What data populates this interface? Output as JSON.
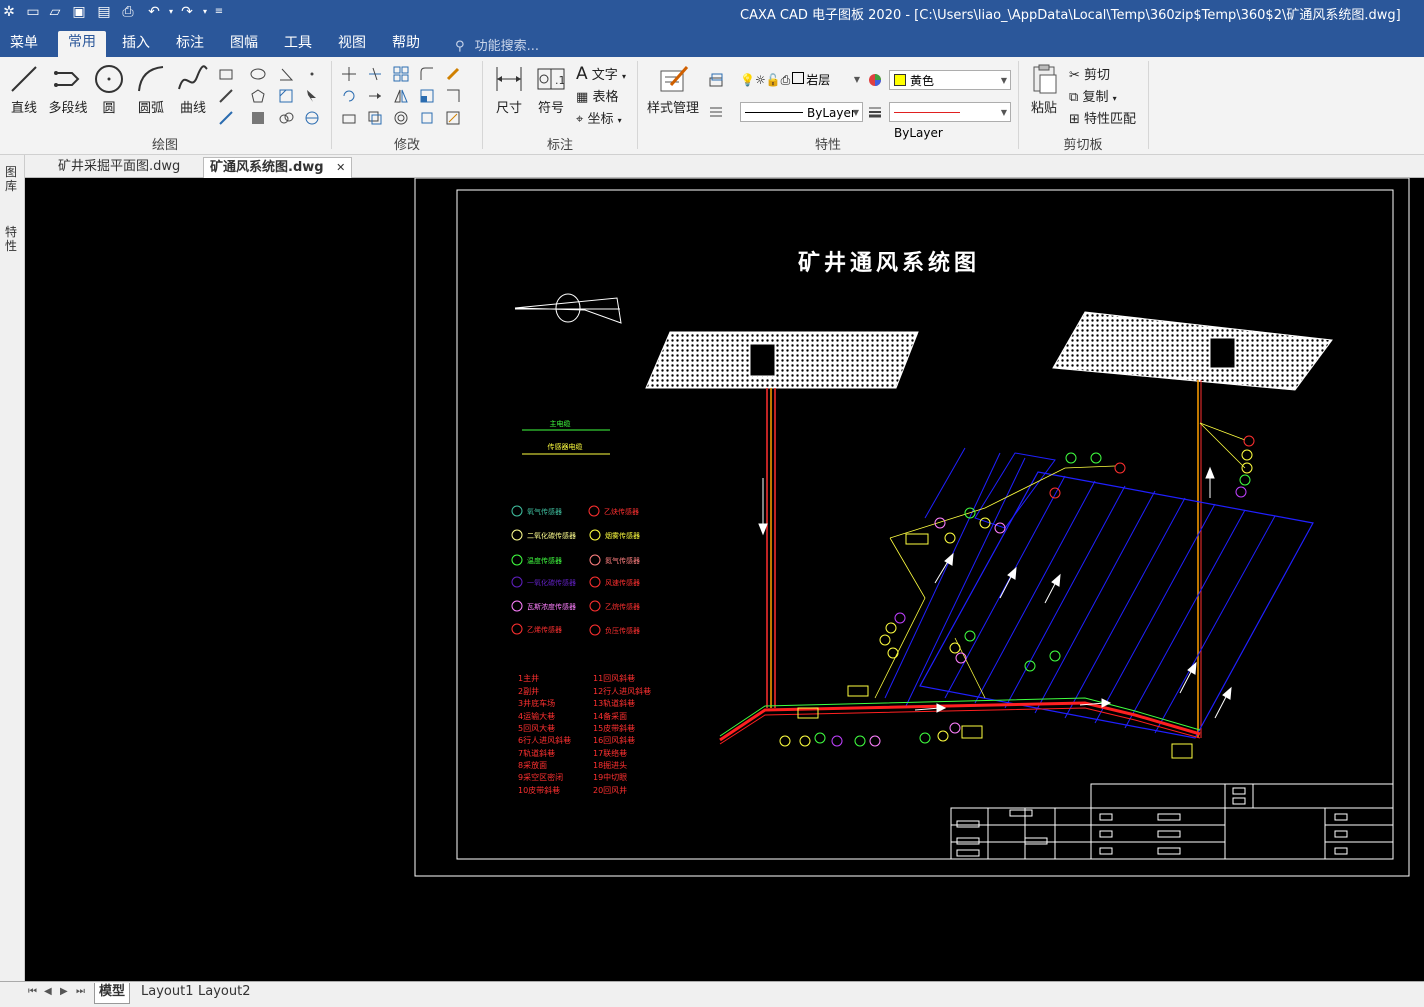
{
  "window": {
    "title": "CAXA CAD 电子图板 2020 - [C:\\Users\\liao_\\AppData\\Local\\Temp\\360zip$Temp\\360$2\\矿通风系统图.dwg]"
  },
  "menu": {
    "tabs": [
      "菜单",
      "常用",
      "插入",
      "标注",
      "图幅",
      "工具",
      "视图",
      "帮助"
    ],
    "active": "常用",
    "search_placeholder": "功能搜索..."
  },
  "ribbon": {
    "draw": {
      "label": "绘图",
      "line": "直线",
      "polyline": "多段线",
      "circle": "圆",
      "arc": "圆弧",
      "curve": "曲线"
    },
    "modify": {
      "label": "修改"
    },
    "annotate": {
      "label": "标注",
      "dimension": "尺寸",
      "symbol": "符号",
      "text": "文字",
      "table": "表格",
      "coord": "坐标"
    },
    "properties": {
      "label": "特性",
      "style_manager": "样式管理",
      "layer": "岩层",
      "color": "黄色",
      "linetype": "ByLayer",
      "lineweight": "ByLayer"
    },
    "clipboard": {
      "label": "剪切板",
      "paste": "粘贴",
      "cut": "剪切",
      "copy": "复制",
      "match": "特性匹配"
    }
  },
  "doc_tabs": [
    "矿井采掘平面图.dwg",
    "矿通风系统图.dwg"
  ],
  "active_doc": "矿通风系统图.dwg",
  "left_palette": [
    "图库",
    "特性"
  ],
  "drawing": {
    "title": "矿井通风系统图",
    "cable_legend": [
      "主电缆",
      "传感器电缆"
    ],
    "sensor_legend_left": [
      "氧气传感器",
      "二氧化碳传感器",
      "温度传感器",
      "一氧化碳传感器",
      "瓦斯浓度传感器",
      "乙烯传感器"
    ],
    "sensor_legend_right": [
      "乙炔传感器",
      "烟雾传感器",
      "氮气传感器",
      "风速传感器",
      "乙烷传感器",
      "负压传感器"
    ],
    "roadway_list_left": [
      "1主井",
      "2副井",
      "3井底车场",
      "4运输大巷",
      "5回风大巷",
      "6行人进风斜巷",
      "7轨道斜巷",
      "8采放面",
      "9采空区密闭",
      "10皮带斜巷"
    ],
    "roadway_list_right": [
      "11回风斜巷",
      "12行人进风斜巷",
      "13轨道斜巷",
      "14备采面",
      "15皮带斜巷",
      "16回风斜巷",
      "17联络巷",
      "18掘进头",
      "19中切眼",
      "20回风井"
    ]
  },
  "layout_tabs": [
    "模型",
    "Layout1",
    "Layout2"
  ],
  "active_layout": "模型",
  "colors": {
    "accent": "#2b579a",
    "layer_color": "#ffff00"
  }
}
